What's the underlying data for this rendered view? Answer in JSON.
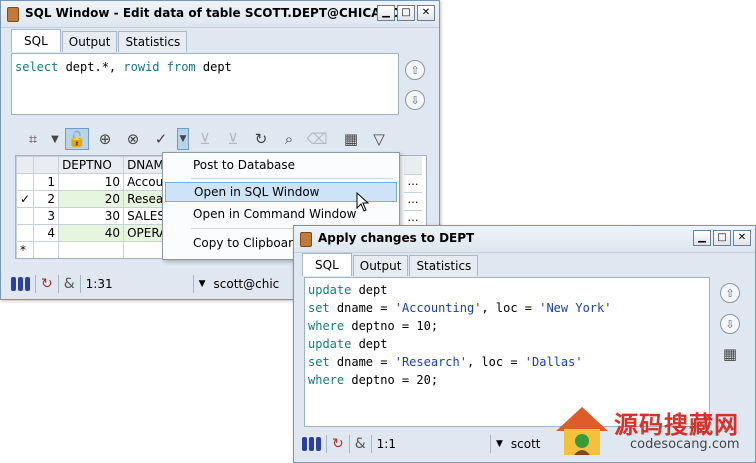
{
  "window1": {
    "title": "SQL Window - Edit data of table SCOTT.DEPT@CHICAGO",
    "tabs": [
      "SQL",
      "Output",
      "Statistics"
    ],
    "sql_kw1": "select",
    "sql_mid": " dept.*, ",
    "sql_kw2": "rowid",
    "sql_sp": " ",
    "sql_kw3": "from",
    "sql_end": " dept",
    "grid": {
      "headers": [
        "",
        "",
        "DEPTNO",
        "DNAME"
      ],
      "rows": [
        {
          "check": "",
          "n": "1",
          "deptno": "10",
          "dname": "Accoun"
        },
        {
          "check": "✓",
          "n": "2",
          "deptno": "20",
          "dname": "Researc"
        },
        {
          "check": "",
          "n": "3",
          "deptno": "30",
          "dname": "SALES"
        },
        {
          "check": "",
          "n": "4",
          "deptno": "40",
          "dname": "OPERAT"
        }
      ],
      "new_row_marker": "*",
      "ellipsis": "…"
    },
    "status": {
      "amp": "&",
      "pos": "1:31",
      "dropdown": "▼",
      "user": "scott@chic"
    }
  },
  "menu": {
    "items": [
      "Post to Database",
      "Open in SQL Window",
      "Open in Command Window",
      "Copy to Clipboard"
    ]
  },
  "window2": {
    "title": "Apply changes to DEPT",
    "tabs": [
      "SQL",
      "Output",
      "Statistics"
    ],
    "lines": [
      [
        {
          "t": "update",
          "c": "kw"
        },
        {
          "t": " dept",
          "c": ""
        }
      ],
      [
        {
          "t": "set",
          "c": "kw"
        },
        {
          "t": " dname = ",
          "c": ""
        },
        {
          "t": "'Accounting'",
          "c": "str"
        },
        {
          "t": ", loc = ",
          "c": ""
        },
        {
          "t": "'New York'",
          "c": "str"
        }
      ],
      [
        {
          "t": "where",
          "c": "kw"
        },
        {
          "t": " deptno = 10;",
          "c": ""
        }
      ],
      [
        {
          "t": "update",
          "c": "kw"
        },
        {
          "t": " dept",
          "c": ""
        }
      ],
      [
        {
          "t": "set",
          "c": "kw"
        },
        {
          "t": " dname = ",
          "c": ""
        },
        {
          "t": "'Research'",
          "c": "str"
        },
        {
          "t": ", loc = ",
          "c": ""
        },
        {
          "t": "'Dallas'",
          "c": "str"
        }
      ],
      [
        {
          "t": "where",
          "c": "kw"
        },
        {
          "t": " deptno = 20;",
          "c": ""
        }
      ]
    ],
    "status": {
      "amp": "&",
      "pos": "1:1",
      "dropdown": "▼",
      "user": "scott"
    }
  },
  "watermark": {
    "cn": "源码搜藏网",
    "url": "codesocang.com"
  },
  "colors": {
    "accent": "#b9d3ec",
    "keyword": "#1a7a7a",
    "string": "#1f3fa8",
    "title_bg": "#dfe8f1"
  }
}
